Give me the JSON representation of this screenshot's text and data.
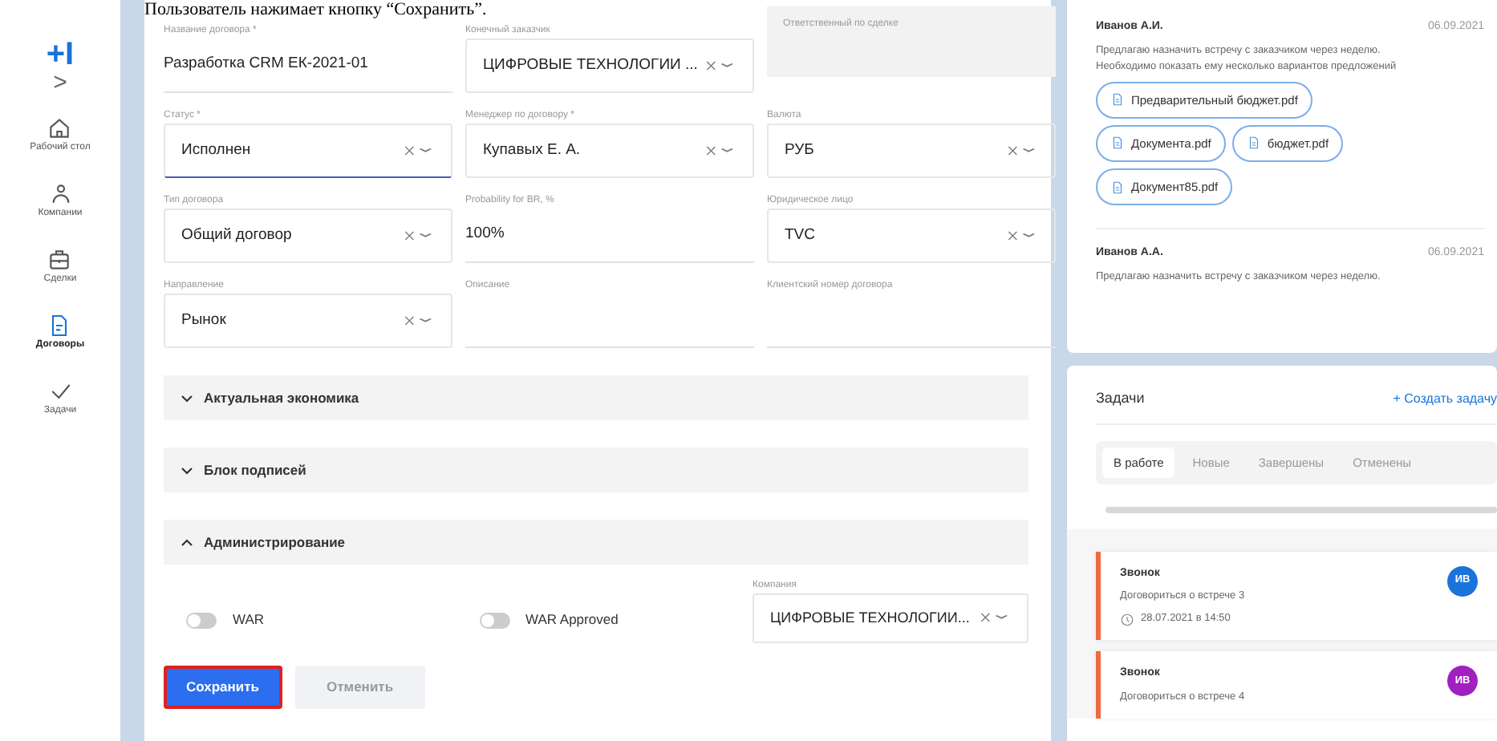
{
  "caption": "Пользователь нажимает кнопку “Сохранить”.",
  "sidebar": {
    "logo": "+I",
    "expand": ">",
    "items": [
      {
        "label": "Рабочий стол",
        "selected": false
      },
      {
        "label": "Компании",
        "selected": false
      },
      {
        "label": "Сделки",
        "selected": false
      },
      {
        "label": "Договоры",
        "selected": true
      },
      {
        "label": "Задачи",
        "selected": false
      }
    ]
  },
  "form": {
    "fields": [
      {
        "label": "Название договора *",
        "kind": "text",
        "value": "Разработка CRM ЕК-2021-01",
        "focused": false
      },
      {
        "label": "Конечный заказчик",
        "kind": "select",
        "value": "ЦИФРОВЫЕ ТЕХНОЛОГИИ ...",
        "focused": false
      },
      {
        "label": "Ответственный по сделке",
        "kind": "disabled"
      },
      {
        "label": "Статус *",
        "kind": "select",
        "value": "Исполнен",
        "focused": true
      },
      {
        "label": "Менеджер по договору *",
        "kind": "select",
        "value": "Купавых Е. А.",
        "focused": false
      },
      {
        "label": "Валюта",
        "kind": "select",
        "value": "РУБ",
        "focused": false
      },
      {
        "label": "Тип договора",
        "kind": "select",
        "value": "Общий договор",
        "focused": false
      },
      {
        "label": "Probability for BR, %",
        "kind": "text",
        "value": "100%",
        "focused": false
      },
      {
        "label": "Юридическое лицо",
        "kind": "select",
        "value": "TVC",
        "focused": false
      },
      {
        "label": "Направление",
        "kind": "select",
        "value": "Рынок",
        "focused": false
      },
      {
        "label": "Описание",
        "kind": "text",
        "focused": false
      },
      {
        "label": "Клиентский номер договора",
        "kind": "text",
        "focused": false
      }
    ],
    "sections": [
      {
        "title": "Актуальная экономика",
        "expanded": false
      },
      {
        "title": "Блок подписей",
        "expanded": false
      },
      {
        "title": "Администрирование",
        "expanded": true
      }
    ],
    "toggles": [
      {
        "label": "WAR",
        "on": false
      },
      {
        "label": "WAR Approved",
        "on": false
      }
    ],
    "company": {
      "label": "Компания",
      "value": "ЦИФРОВЫЕ ТЕХНОЛОГИИ..."
    },
    "buttons": [
      {
        "label": "Сохранить",
        "kind": "primary",
        "highlighted": true
      },
      {
        "label": "Отменить",
        "kind": "secondary",
        "highlighted": false
      }
    ]
  },
  "comments": [
    {
      "author": "Иванов А.И.",
      "date": "06.09.2021",
      "text": [
        "Предлагаю назначить встречу с заказчиком через неделю.",
        "Необходимо показать ему несколько вариантов предложений"
      ],
      "files": [
        "Предварительный бюджет.pdf",
        "Документа.pdf",
        "бюджет.pdf",
        "Документ85.pdf"
      ]
    },
    {
      "author": "Иванов А.А.",
      "date": "06.09.2021",
      "text": [
        "Предлагаю назначить встречу с заказчиком через неделю."
      ]
    }
  ],
  "tasks": {
    "title": "Задачи",
    "create": "+ Создать задачу",
    "tabs": [
      {
        "label": "В работе",
        "selected": true
      },
      {
        "label": "Новые",
        "selected": false
      },
      {
        "label": "Завершены",
        "selected": false
      },
      {
        "label": "Отменены",
        "selected": false
      }
    ],
    "items": [
      {
        "title": "Звонок",
        "description": "Договориться о встрече 3",
        "time": "28.07.2021 в 14:50",
        "initials": "ИВ",
        "color": "#1a73d9"
      },
      {
        "title": "Звонок",
        "description": "Договориться о встрече 4",
        "initials": "ИВ",
        "color": "#a020c0"
      }
    ]
  }
}
